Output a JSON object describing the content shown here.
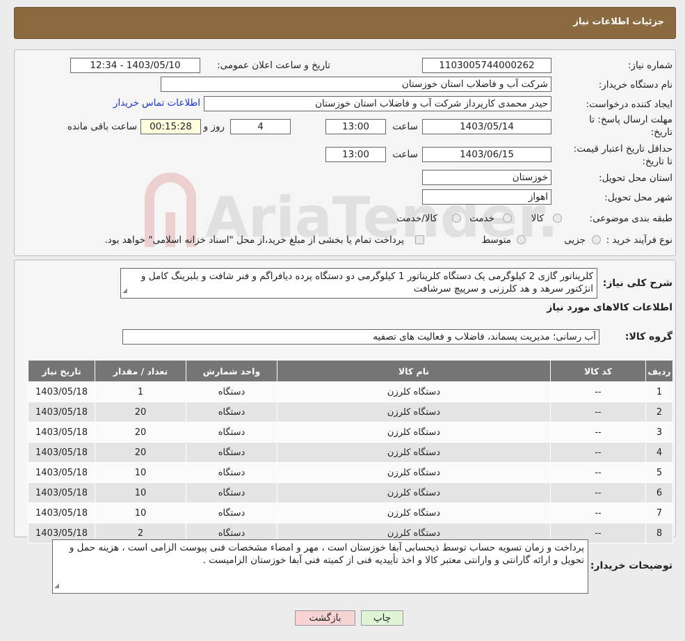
{
  "header": {
    "title": "جزئیات اطلاعات نیاز"
  },
  "form": {
    "need_number_label": "شماره نیاز:",
    "need_number": "1103005744000262",
    "announce_label": "تاریخ و ساعت اعلان عمومی:",
    "announce_value": "1403/05/10 - 12:34",
    "buyer_org_label": "نام دستگاه خریدار:",
    "buyer_org": "شرکت آب و فاضلاب استان خوزستان",
    "creator_label": "ایجاد کننده درخواست:",
    "creator": "حیدر محمدی کارپرداز شرکت آب و فاضلاب استان خوزستان",
    "contact_link": "اطلاعات تماس خریدار",
    "reply_deadline_label": "مهلت ارسال پاسخ: تا تاریخ:",
    "reply_date": "1403/05/14",
    "time_label": "ساعت",
    "reply_time": "13:00",
    "days": "4",
    "days_label": "روز و",
    "remaining": "00:15:28",
    "remaining_label": "ساعت باقی مانده",
    "price_validity_label": "حداقل تاریخ اعتبار قیمت: تا تاریخ:",
    "validity_date": "1403/06/15",
    "validity_time": "13:00",
    "province_label": "استان محل تحویل:",
    "province": "خوزستان",
    "city_label": "شهر محل تحویل:",
    "city": "اهواز",
    "category_label": "طبقه بندی موضوعی:",
    "category_options": [
      "کالا",
      "خدمت",
      "کالا/خدمت"
    ],
    "purchase_type_label": "نوع فرآیند خرید :",
    "purchase_options": [
      "جزیی",
      "متوسط"
    ],
    "purchase_note": "پرداخت تمام یا بخشی از مبلغ خرید،از محل \"اسناد خزانه اسلامی\" خواهد بود."
  },
  "summary": {
    "label": "شرح کلی نیاز:",
    "text": "کلریناتور گازی 2 کیلوگرمی یک دستگاه کلریناتور 1 کیلوگرمی دو دستگاه پرده دیافراگم و فنر شافت و بلبرینگ کامل و انژکتور سرهد و هد کلرزنی و سرپیچ سرشافت",
    "items_heading": "اطلاعات کالاهای مورد نیاز",
    "group_label": "گروه کالا:",
    "group_value": "آب رسانی؛ مدیریت پسماند، فاضلاب و فعالیت های تصفیه"
  },
  "table": {
    "headers": [
      "ردیف",
      "کد کالا",
      "نام کالا",
      "واحد شمارش",
      "تعداد / مقدار",
      "تاریخ نیاز"
    ],
    "rows": [
      [
        "1",
        "--",
        "دستگاه کلرزن",
        "دستگاه",
        "1",
        "1403/05/18"
      ],
      [
        "2",
        "--",
        "دستگاه کلرزن",
        "دستگاه",
        "20",
        "1403/05/18"
      ],
      [
        "3",
        "--",
        "دستگاه کلرزن",
        "دستگاه",
        "20",
        "1403/05/18"
      ],
      [
        "4",
        "--",
        "دستگاه کلرزن",
        "دستگاه",
        "20",
        "1403/05/18"
      ],
      [
        "5",
        "--",
        "دستگاه کلرزن",
        "دستگاه",
        "10",
        "1403/05/18"
      ],
      [
        "6",
        "--",
        "دستگاه کلرزن",
        "دستگاه",
        "10",
        "1403/05/18"
      ],
      [
        "7",
        "--",
        "دستگاه کلرزن",
        "دستگاه",
        "10",
        "1403/05/18"
      ],
      [
        "8",
        "--",
        "دستگاه کلرزن",
        "دستگاه",
        "2",
        "1403/05/18"
      ]
    ]
  },
  "buyer_notes": {
    "label": "توضیحات خریدار:",
    "text": "پرداخت و زمان تسویه حساب توسط ذیحسابی آبفا خوزستان است ، مهر و امضاء مشخصات فنی پیوست الزامی است ، هزینه حمل و تحویل و ارائه گارانتی و وارانتی معتبر کالا و اخذ تأییدیه فنی از کمیته فنی آبفا خوزستان الزامیست ."
  },
  "buttons": {
    "print": "چاپ",
    "back": "بازگشت"
  },
  "watermark": {
    "text": "AriaTender.neT"
  },
  "colors": {
    "header": "#8b6a40",
    "table_header": "#757575",
    "link": "#1b35c8",
    "back_button": "#f7d3d3",
    "print_button": "#dff3d5"
  }
}
